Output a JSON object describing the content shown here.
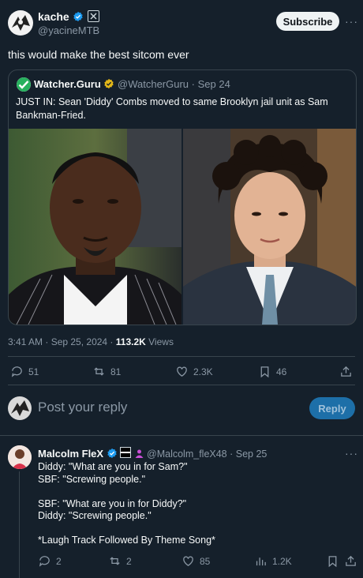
{
  "tweet": {
    "author_name": "kache",
    "author_handle": "@yacineMTB",
    "subscribe_label": "Subscribe",
    "more_label": "···",
    "text": "this would make the best sitcom ever",
    "timestamp": "3:41 AM · Sep 25, 2024 · ",
    "views_count": "113.2K",
    "views_label": " Views",
    "stats": {
      "replies": "51",
      "reposts": "81",
      "likes": "2.3K",
      "bookmarks": "46"
    }
  },
  "quote": {
    "author_name": "Watcher.Guru",
    "author_handle": "@WatcherGuru",
    "date": "· Sep 24",
    "text_line1": "JUST IN: Sean 'Diddy' Combs moved to same Brooklyn jail unit as Sam",
    "text_line2": "Bankman-Fried."
  },
  "composer": {
    "placeholder": "Post your reply",
    "reply_button": "Reply"
  },
  "reply": {
    "author_name": "Malcolm FleX",
    "author_handle": "@Malcolm_fleX48",
    "date": "· Sep 25",
    "more_label": "···",
    "text": "Diddy: \"What are you in for Sam?\"\nSBF: \"Screwing people.\"\n\nSBF: \"What are you in for Diddy?\"\nDiddy: \"Screwing people.\"\n\n*Laugh Track Followed By Theme Song*",
    "stats": {
      "replies": "2",
      "reposts": "2",
      "likes": "85",
      "views": "1.2K"
    }
  },
  "colors": {
    "background": "#15202b",
    "verified": "#1d9bf0",
    "gold_badge": "#e2b719",
    "reply_button": "#1d6fa8"
  }
}
